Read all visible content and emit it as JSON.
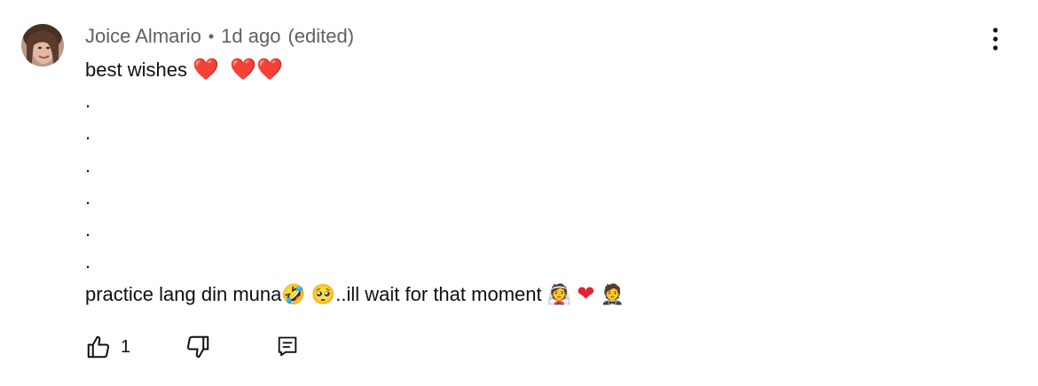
{
  "comment": {
    "author": "Joice Almario",
    "separator": "•",
    "time": "1d ago",
    "edited": "(edited)",
    "lines": [
      "best wishes",
      ".",
      ".",
      ".",
      ".",
      ".",
      ".",
      "practice lang din muna",
      "..ill wait for that moment"
    ],
    "emojis": {
      "hearts_line1": [
        "❤️",
        "❤️",
        "❤️"
      ],
      "rofl": "🤣",
      "pleading": "🥺",
      "bride": "👰",
      "heart_mid": "❤",
      "groom": "🤵"
    }
  },
  "actions": {
    "like_count": "1"
  },
  "icons": {
    "menu": "more-vertical-icon",
    "like": "thumbs-up-icon",
    "dislike": "thumbs-down-icon",
    "reply": "reply-icon"
  },
  "colors": {
    "text": "#0f0f0f",
    "meta": "#606060",
    "heart": "#e0242f"
  }
}
